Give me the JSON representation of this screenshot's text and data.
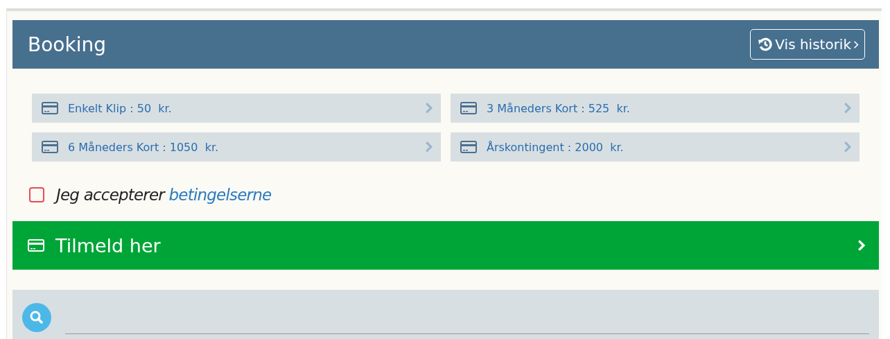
{
  "header": {
    "title": "Booking",
    "history_button": "Vis historik"
  },
  "options": [
    {
      "label": "Enkelt Klip : 50  kr."
    },
    {
      "label": "3 Måneders Kort : 525  kr."
    },
    {
      "label": "6 Måneders Kort : 1050  kr."
    },
    {
      "label": "Årskontingent : 2000  kr."
    }
  ],
  "terms": {
    "checked": false,
    "text": "Jeg accepterer",
    "link": "betingelserne"
  },
  "signup_button": "Tilmeld her"
}
